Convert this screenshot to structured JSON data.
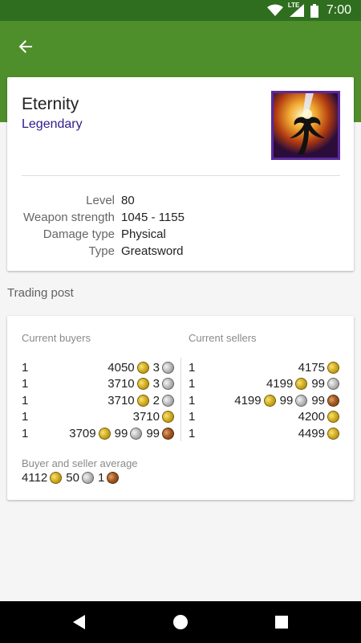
{
  "status_bar": {
    "time": "7:00",
    "network_label": "LTE",
    "icons": [
      "wifi-icon",
      "cellular-icon",
      "battery-icon"
    ]
  },
  "app_bar": {
    "color": "#4f8f2b",
    "status_color": "#2e6e1e",
    "back_icon": "arrow-back-icon"
  },
  "item": {
    "name": "Eternity",
    "rarity": "Legendary",
    "rarity_color": "#2f1d8c",
    "icon": "eternity-weapon-icon",
    "stats": [
      {
        "label": "Level",
        "value": "80"
      },
      {
        "label": "Weapon strength",
        "value": "1045 - 1155"
      },
      {
        "label": "Damage type",
        "value": "Physical"
      },
      {
        "label": "Type",
        "value": "Greatsword"
      }
    ]
  },
  "trading_post": {
    "title": "Trading post",
    "buyers_header": "Current buyers",
    "sellers_header": "Current sellers",
    "buyers": [
      {
        "qty": "1",
        "gold": "4050",
        "silver": "3",
        "copper": null
      },
      {
        "qty": "1",
        "gold": "3710",
        "silver": "3",
        "copper": null
      },
      {
        "qty": "1",
        "gold": "3710",
        "silver": "2",
        "copper": null
      },
      {
        "qty": "1",
        "gold": "3710",
        "silver": null,
        "copper": null
      },
      {
        "qty": "1",
        "gold": "3709",
        "silver": "99",
        "copper": "99"
      }
    ],
    "sellers": [
      {
        "qty": "1",
        "gold": "4175",
        "silver": null,
        "copper": null
      },
      {
        "qty": "1",
        "gold": "4199",
        "silver": "99",
        "copper": null
      },
      {
        "qty": "1",
        "gold": "4199",
        "silver": "99",
        "copper": "99"
      },
      {
        "qty": "1",
        "gold": "4200",
        "silver": null,
        "copper": null
      },
      {
        "qty": "1",
        "gold": "4499",
        "silver": null,
        "copper": null
      }
    ],
    "average_label": "Buyer and seller average",
    "average": {
      "gold": "4112",
      "silver": "50",
      "copper": "1"
    }
  },
  "nav_bar": {
    "buttons": [
      "back-triangle-icon",
      "home-circle-icon",
      "recents-square-icon"
    ]
  }
}
